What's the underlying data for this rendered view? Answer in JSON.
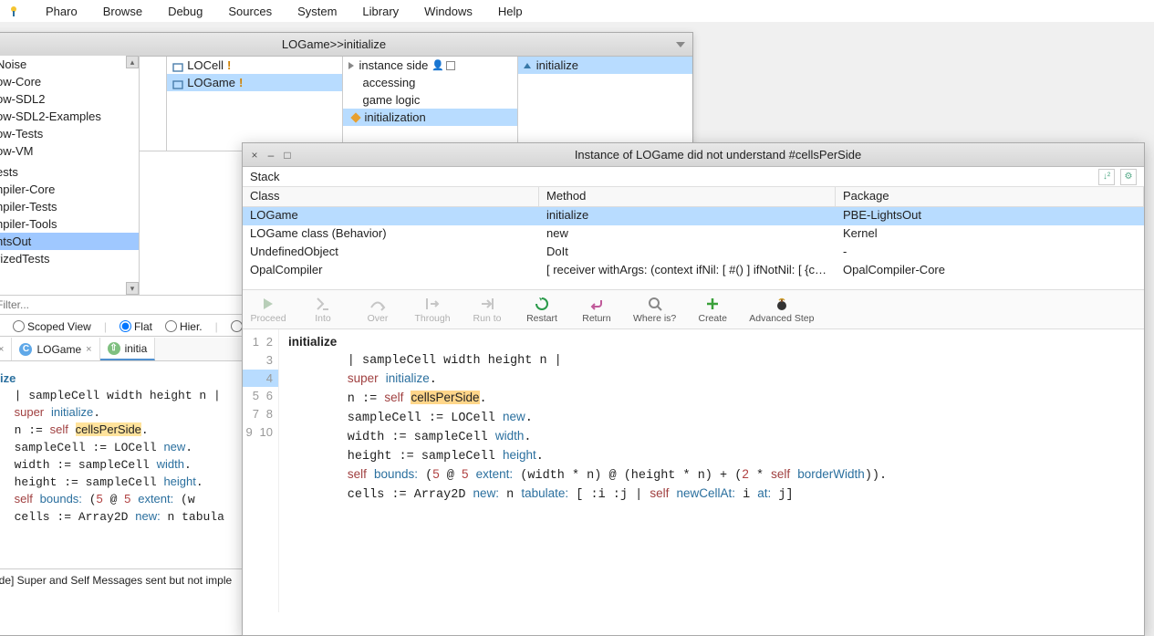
{
  "menubar": [
    "Pharo",
    "Browse",
    "Debug",
    "Sources",
    "System",
    "Library",
    "Windows",
    "Help"
  ],
  "browser": {
    "title": "LOGame>>initialize",
    "packages": [
      "Noise",
      "ow-Core",
      "ow-SDL2",
      "ow-SDL2-Examples",
      "ow-Tests",
      "ow-VM",
      "",
      "ests",
      "npiler-Core",
      "npiler-Tests",
      "npiler-Tools",
      "ntsOut",
      "rizedTests"
    ],
    "selectedPackage": "ntsOut",
    "classes": [
      {
        "name": "LOCell",
        "exclaim": true
      },
      {
        "name": "LOGame",
        "exclaim": true
      }
    ],
    "selectedClass": "LOGame",
    "protocols": [
      {
        "name": "instance side",
        "icon": "tri-right",
        "extra": true
      },
      {
        "name": "accessing"
      },
      {
        "name": "game logic"
      },
      {
        "name": "initialization",
        "icon": "diamond"
      }
    ],
    "selectedProtocol": "initialization",
    "methods": [
      {
        "name": "initialize",
        "icon": "tri-up"
      }
    ],
    "selectedMethod": "initialize",
    "filterPlaceholder": "Filter...",
    "radios": {
      "scoped": "Scoped View",
      "flat": "Flat",
      "hier": "Hier."
    },
    "tabs": [
      {
        "kind": "c",
        "label": "LOGame"
      },
      {
        "kind": "m",
        "label": "initia",
        "active": true
      }
    ],
    "status": "ide] Super and Self Messages sent but not imple"
  },
  "sourceLines": [
    "ize",
    "  | sampleCell width height n |",
    "  super initialize.",
    "  n := self cellsPerSide.",
    "  sampleCell := LOCell new.",
    "  width := sampleCell width.",
    "  height := sampleCell height.",
    "  self bounds: (5 @ 5 extent: (w",
    "  cells := Array2D new: n tabula"
  ],
  "debugger": {
    "title": "Instance of LOGame did not understand #cellsPerSide",
    "stackLabel": "Stack",
    "columns": {
      "class": "Class",
      "method": "Method",
      "package": "Package"
    },
    "rows": [
      {
        "class": "LOGame",
        "method": "initialize",
        "package": "PBE-LightsOut",
        "selected": true
      },
      {
        "class": "LOGame class (Behavior)",
        "method": "new",
        "package": "Kernel"
      },
      {
        "class": "UndefinedObject",
        "method": "DoIt",
        "package": "-"
      },
      {
        "class": "OpalCompiler",
        "method": "[ receiver withArgs: (context ifNil: [ #() ] ifNotNil: [ {context} ])",
        "package": "OpalCompiler-Core"
      }
    ],
    "tools": [
      {
        "name": "Proceed",
        "disabled": true
      },
      {
        "name": "Into",
        "disabled": true
      },
      {
        "name": "Over",
        "disabled": true
      },
      {
        "name": "Through",
        "disabled": true
      },
      {
        "name": "Run to",
        "disabled": true
      },
      {
        "name": "Restart"
      },
      {
        "name": "Return"
      },
      {
        "name": "Where is?"
      },
      {
        "name": "Create"
      },
      {
        "name": "Advanced Step"
      }
    ],
    "code": {
      "currentLine": 4,
      "lines": 10
    }
  }
}
